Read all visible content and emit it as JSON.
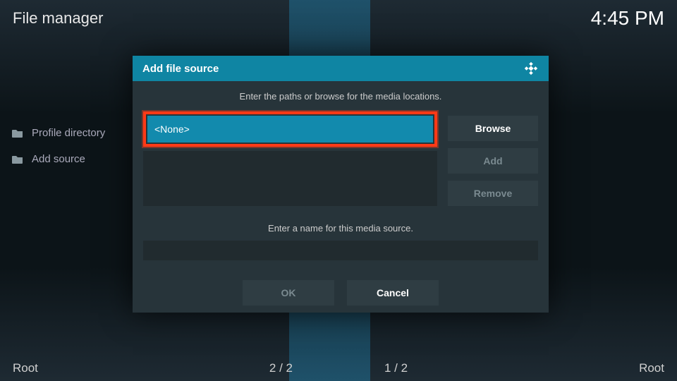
{
  "header": {
    "title": "File manager",
    "clock": "4:45 PM"
  },
  "sidebar": {
    "items": [
      {
        "label": "Profile directory",
        "icon": "folder"
      },
      {
        "label": "Add source",
        "icon": "folder"
      }
    ]
  },
  "footer": {
    "left": "Root",
    "count_left": "2 / 2",
    "count_right": "1 / 2",
    "right": "Root"
  },
  "dialog": {
    "title": "Add file source",
    "instruction": "Enter the paths or browse for the media locations.",
    "path_value": "<None>",
    "browse_label": "Browse",
    "add_label": "Add",
    "remove_label": "Remove",
    "name_instruction": "Enter a name for this media source.",
    "name_value": "",
    "ok_label": "OK",
    "cancel_label": "Cancel"
  }
}
